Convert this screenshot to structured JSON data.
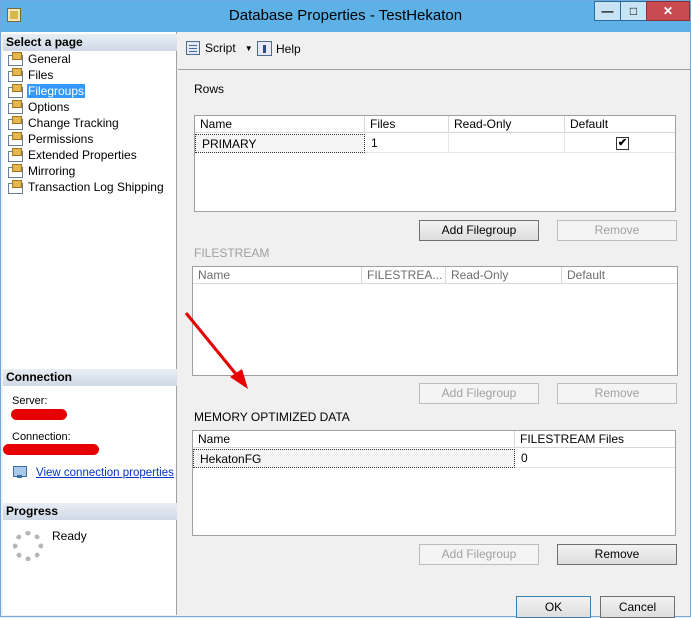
{
  "window": {
    "title": "Database Properties - TestHekaton"
  },
  "left_pane": {
    "select_page_header": "Select a page",
    "pages": [
      {
        "label": "General",
        "selected": false
      },
      {
        "label": "Files",
        "selected": false
      },
      {
        "label": "Filegroups",
        "selected": true
      },
      {
        "label": "Options",
        "selected": false
      },
      {
        "label": "Change Tracking",
        "selected": false
      },
      {
        "label": "Permissions",
        "selected": false
      },
      {
        "label": "Extended Properties",
        "selected": false
      },
      {
        "label": "Mirroring",
        "selected": false
      },
      {
        "label": "Transaction Log Shipping",
        "selected": false
      }
    ],
    "connection": {
      "header": "Connection",
      "server_label": "Server:",
      "connection_label": "Connection:",
      "view_link": "View connection properties"
    },
    "progress": {
      "header": "Progress",
      "status": "Ready"
    }
  },
  "toolbar": {
    "script_label": "Script",
    "help_label": "Help"
  },
  "rows_section": {
    "label": "Rows",
    "columns": [
      "Name",
      "Files",
      "Read-Only",
      "Default"
    ],
    "rows": [
      {
        "name": "PRIMARY",
        "files": "1",
        "read_only": "",
        "default": "✔"
      }
    ],
    "add_button": "Add Filegroup",
    "remove_button": "Remove"
  },
  "filestream_section": {
    "label": "FILESTREAM",
    "columns": [
      "Name",
      "FILESTREA...",
      "Read-Only",
      "Default"
    ],
    "add_button": "Add Filegroup",
    "remove_button": "Remove"
  },
  "memory_section": {
    "label": "MEMORY OPTIMIZED DATA",
    "columns": [
      "Name",
      "FILESTREAM Files"
    ],
    "rows": [
      {
        "name": "HekatonFG",
        "files": "0"
      }
    ],
    "add_button": "Add Filegroup",
    "remove_button": "Remove"
  },
  "footer": {
    "ok_label": "OK",
    "cancel_label": "Cancel"
  },
  "colors": {
    "titlebar": "#5eb1e6",
    "close_button": "#c74b50",
    "annotation_arrow": "#e60000",
    "selection": "#3399ff"
  }
}
